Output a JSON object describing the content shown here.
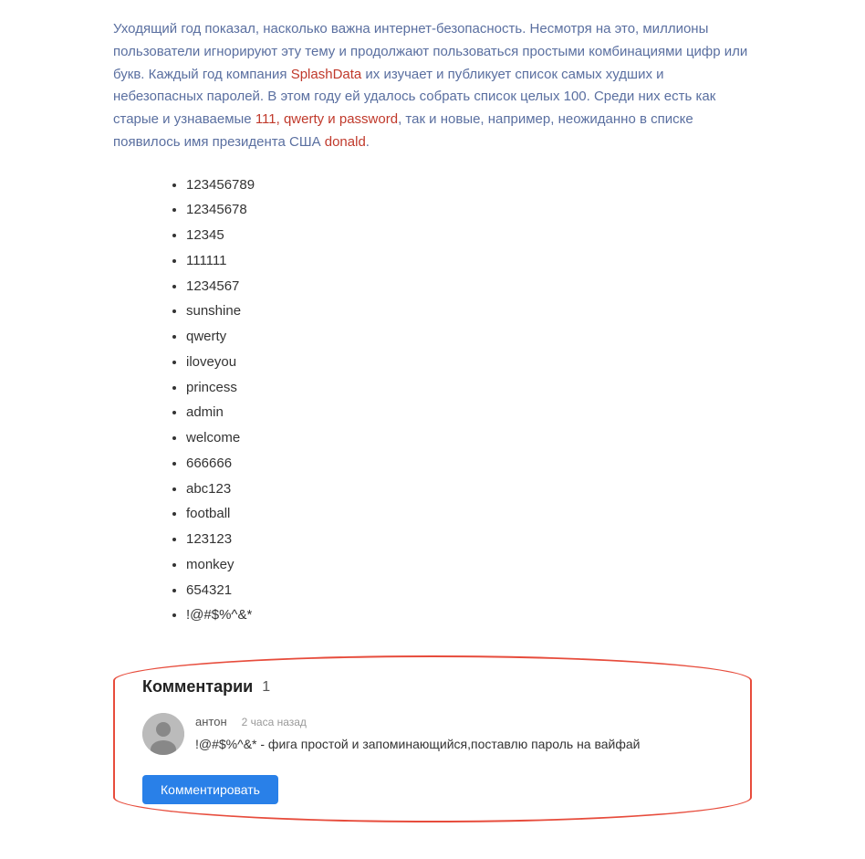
{
  "article": {
    "paragraph": "Уходящий год показал, насколько важна интернет-безопасность. Несмотря на это, миллионы пользователи игнорируют эту тему и продолжают пользоваться простыми комбинациями цифр или букв. Каждый год компания SplashData их изучает и публикует список самых худших и небезопасных паролей. В этом году ей удалось собрать список целых 100. Среди них есть как старые и узнаваемые 111, qwerty и password, так и новые, например, неожиданно в списке появилось имя президента США donald.",
    "highlight_words": [
      "SplashData",
      "111, qwerty и password",
      "donald"
    ]
  },
  "passwords": [
    "123456789",
    "12345678",
    "12345",
    "111111",
    "1234567",
    "sunshine",
    "qwerty",
    "iloveyou",
    "princess",
    "admin",
    "welcome",
    "666666",
    "abc123",
    "football",
    "123123",
    "monkey",
    "654321",
    "!@#$%^&*"
  ],
  "comments": {
    "section_title": "Комментарии",
    "count": "1",
    "items": [
      {
        "author": "антон",
        "time": "2 часа назад",
        "text": "!@#$%^&* - фига простой и запоминающийся,поставлю пароль на вайфай"
      }
    ],
    "button_label": "Комментировать"
  }
}
